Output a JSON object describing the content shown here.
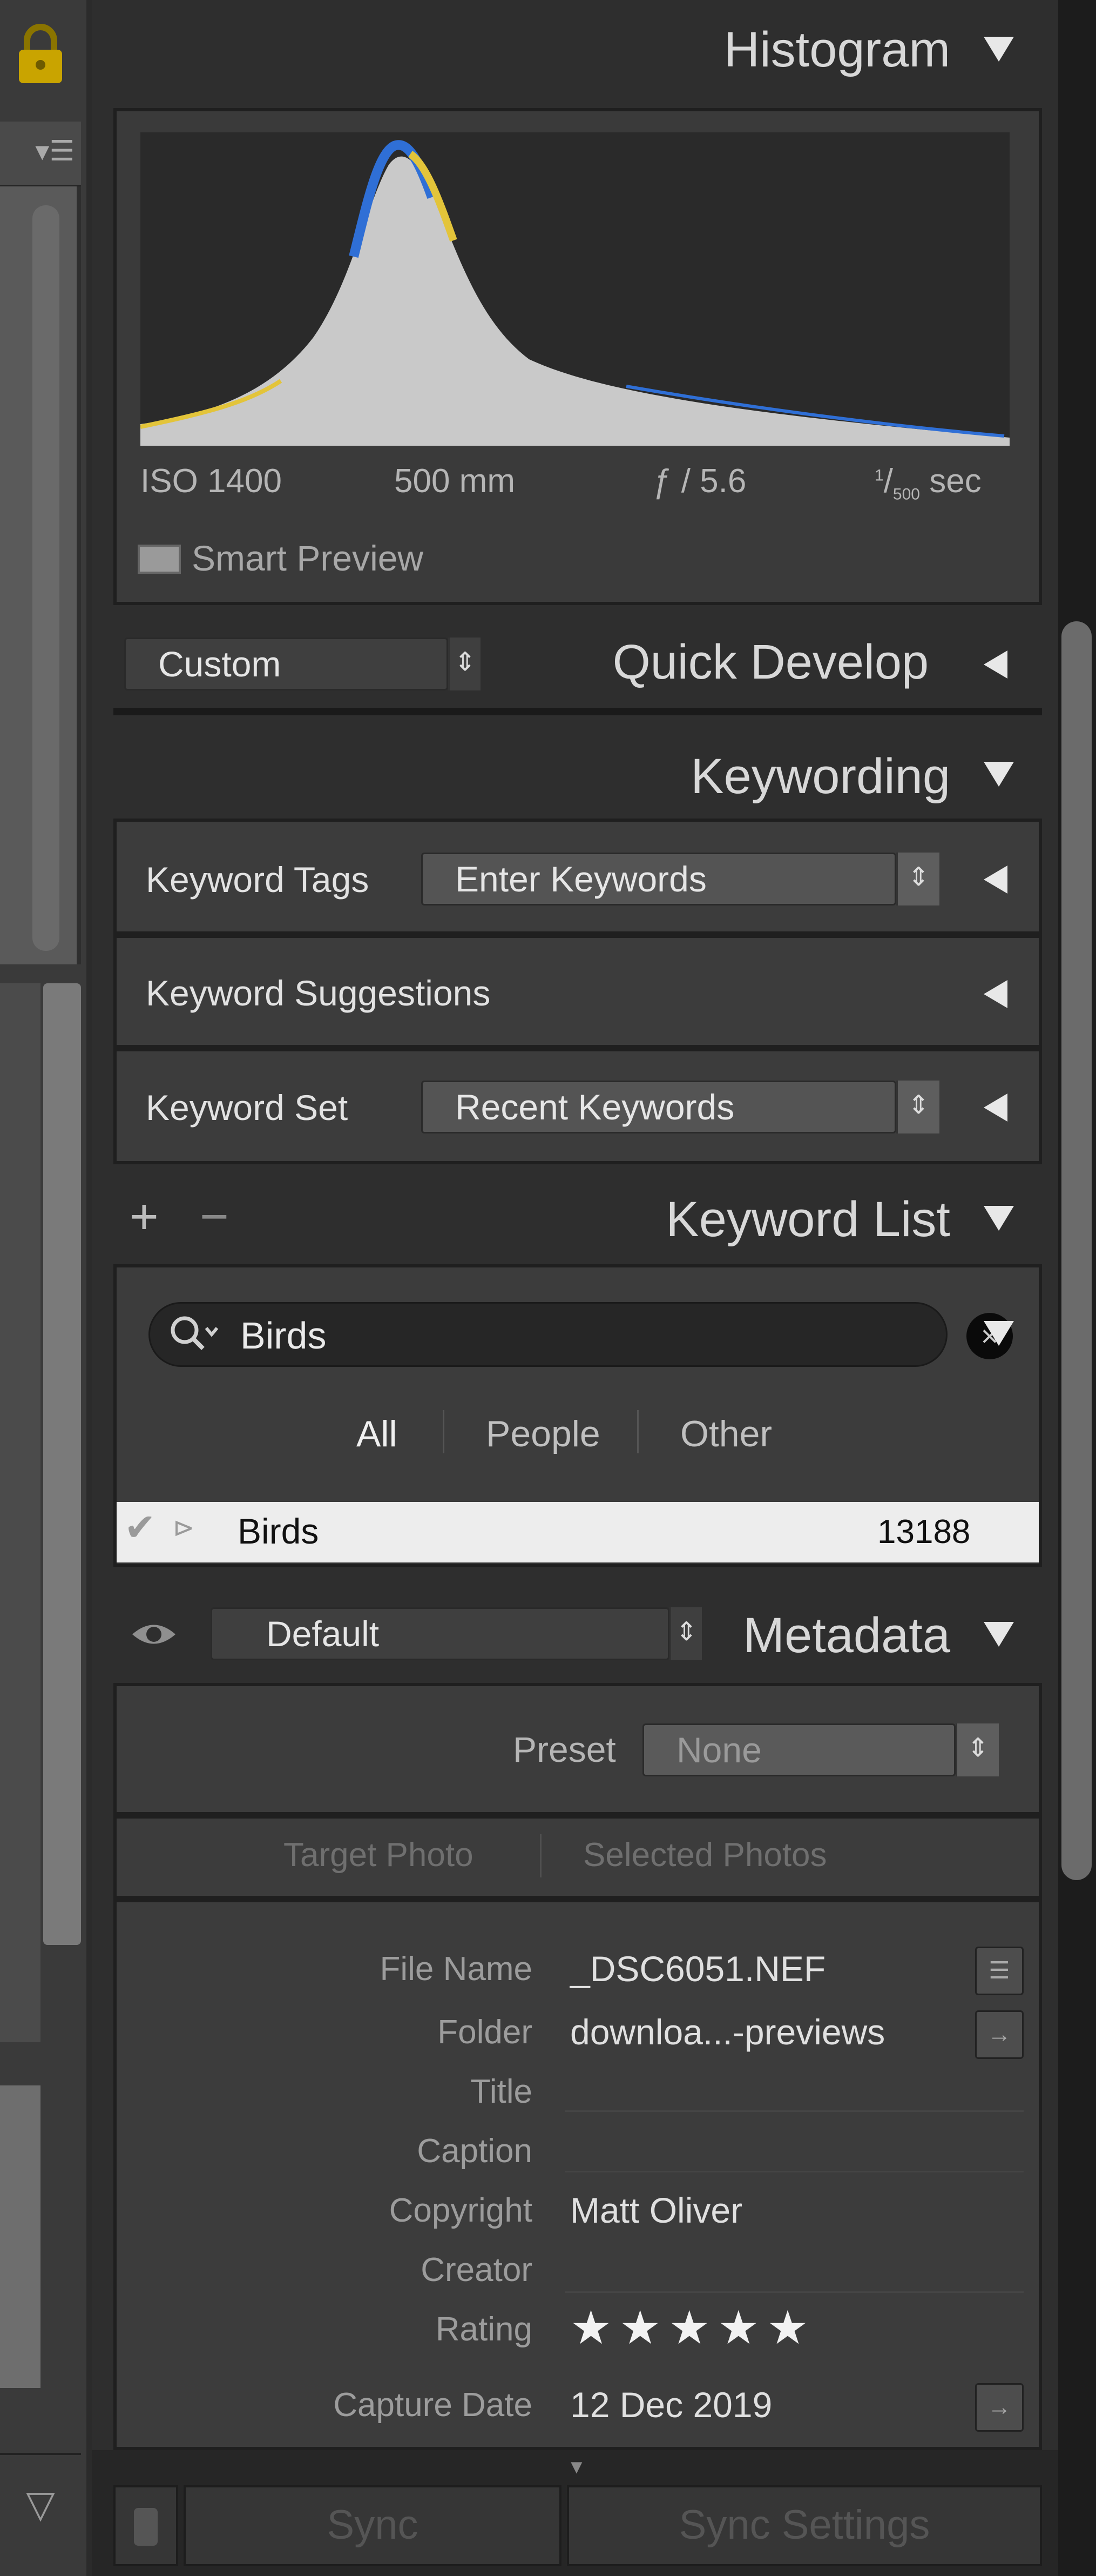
{
  "histogram": {
    "title": "Histogram",
    "iso": "ISO 1400",
    "focal_length": "500 mm",
    "aperture": "ƒ / 5.6",
    "shutter_num": "1",
    "shutter_den": "500",
    "shutter_unit": "sec",
    "smart_preview": "Smart Preview"
  },
  "quick_develop": {
    "title": "Quick Develop",
    "preset_value": "Custom"
  },
  "keywording": {
    "title": "Keywording",
    "tags_label": "Keyword Tags",
    "tags_value": "Enter Keywords",
    "suggestions_label": "Keyword Suggestions",
    "set_label": "Keyword Set",
    "set_value": "Recent Keywords"
  },
  "keyword_list": {
    "title": "Keyword List",
    "add_symbol": "+",
    "remove_symbol": "−",
    "search_value": "Birds",
    "filters": [
      "All",
      "People",
      "Other"
    ],
    "row": {
      "name": "Birds",
      "count": "13188"
    }
  },
  "metadata": {
    "title": "Metadata",
    "preset_value_top": "Default",
    "preset_label": "Preset",
    "preset_value": "None",
    "tabs": [
      "Target Photo",
      "Selected Photos"
    ],
    "fields": [
      {
        "label": "File Name",
        "value": "_DSC6051.NEF"
      },
      {
        "label": "Folder",
        "value": "downloa...-previews"
      },
      {
        "label": "Title",
        "value": ""
      },
      {
        "label": "Caption",
        "value": ""
      },
      {
        "label": "Copyright",
        "value": "Matt Oliver"
      },
      {
        "label": "Creator",
        "value": ""
      },
      {
        "label": "Rating",
        "value": "★★★★★"
      },
      {
        "label": "Capture Date",
        "value": "12 Dec 2019"
      }
    ]
  },
  "footer": {
    "sync": "Sync",
    "sync_settings": "Sync Settings"
  },
  "colors": {
    "panel_bg": "#2e2e2e",
    "box_bg": "#3c3c3c",
    "selected_row_bg": "#ededed",
    "lock_icon": "#c9a400",
    "histogram_blue": "#2f6fd6",
    "histogram_yellow": "#e3c43a",
    "histogram_fill": "#c9c9c9"
  }
}
